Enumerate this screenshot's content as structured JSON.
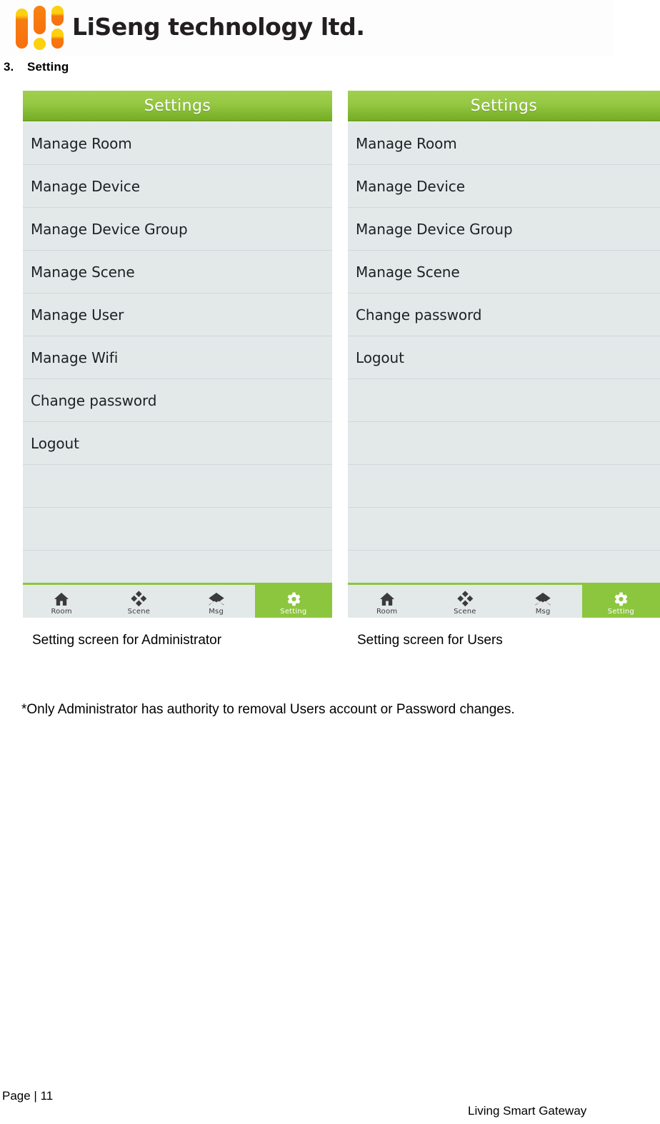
{
  "brand": {
    "logo_text": "LiSeng technology ltd.",
    "logo_icon": "liseng-bars-logo",
    "colors": {
      "orange": "#f7700f",
      "yellow": "#fdd010"
    }
  },
  "section": {
    "number": "3.",
    "title": "Setting"
  },
  "theme": {
    "accent_green": "#8cc63e",
    "titlebar_green_top": "#a1cf4f",
    "titlebar_green_bottom": "#72ab22",
    "list_background": "#e3e8e9",
    "list_divider": "#d2d9da"
  },
  "screens": [
    {
      "id": "admin",
      "titlebar": "Settings",
      "caption": "Setting screen for Administrator",
      "items": [
        {
          "label": "Manage Room"
        },
        {
          "label": "Manage Device"
        },
        {
          "label": "Manage Device Group"
        },
        {
          "label": "Manage Scene"
        },
        {
          "label": "Manage User"
        },
        {
          "label": "Manage Wifi"
        },
        {
          "label": "Change password"
        },
        {
          "label": "Logout"
        }
      ],
      "tabs": [
        {
          "label": "Room",
          "icon": "home-icon",
          "active": false
        },
        {
          "label": "Scene",
          "icon": "diamond-cluster-icon",
          "active": false
        },
        {
          "label": "Msg",
          "icon": "envelope-icon",
          "active": false
        },
        {
          "label": "Setting",
          "icon": "gear-icon",
          "active": true
        }
      ]
    },
    {
      "id": "user",
      "titlebar": "Settings",
      "caption": "Setting screen for Users",
      "items": [
        {
          "label": "Manage Room"
        },
        {
          "label": "Manage Device"
        },
        {
          "label": "Manage Device Group"
        },
        {
          "label": "Manage Scene"
        },
        {
          "label": "Change password"
        },
        {
          "label": "Logout"
        }
      ],
      "tabs": [
        {
          "label": "Room",
          "icon": "home-icon",
          "active": false
        },
        {
          "label": "Scene",
          "icon": "diamond-cluster-icon",
          "active": false
        },
        {
          "label": "Msg",
          "icon": "envelope-icon",
          "active": false
        },
        {
          "label": "Setting",
          "icon": "gear-icon",
          "active": true
        }
      ]
    }
  ],
  "note": "*Only Administrator has authority to removal Users account or Password changes.",
  "footer": {
    "page": "Page | 11",
    "product": "Living Smart Gateway"
  }
}
